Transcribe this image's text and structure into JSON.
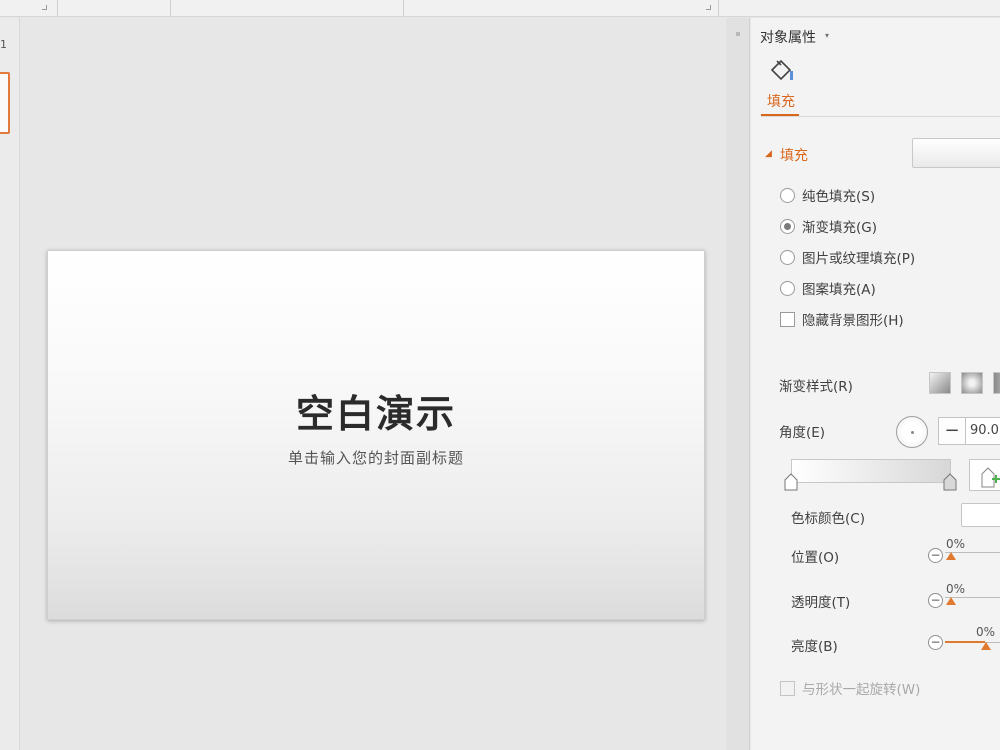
{
  "colors": {
    "accent": "#d9681e",
    "slider_thumb": "#e07a31"
  },
  "thumbnail": {
    "slide_number": "1"
  },
  "slide": {
    "title": "空白演示",
    "subtitle": "单击输入您的封面副标题"
  },
  "pane": {
    "title": "对象属性",
    "title_caret": "▾",
    "tab_fill": {
      "label": "填充",
      "icon": "paint-bucket-icon"
    },
    "section": {
      "caret": "◢",
      "title": "填充"
    },
    "fill_options": [
      {
        "label": "纯色填充(S)",
        "selected": false
      },
      {
        "label": "渐变填充(G)",
        "selected": true
      },
      {
        "label": "图片或纹理填充(P)",
        "selected": false
      },
      {
        "label": "图案填充(A)",
        "selected": false
      }
    ],
    "hide_background": {
      "label": "隐藏背景图形(H)",
      "checked": false
    },
    "gradient_style": {
      "label": "渐变样式(R)"
    },
    "angle": {
      "label": "角度(E)",
      "minus": "−",
      "value": "90.0"
    },
    "stop_color": {
      "label": "色标颜色(C)"
    },
    "position": {
      "label": "位置(O)",
      "minus": "−",
      "value": "0%"
    },
    "transparency": {
      "label": "透明度(T)",
      "minus": "−",
      "value": "0%"
    },
    "brightness": {
      "label": "亮度(B)",
      "minus": "−",
      "value": "0%"
    },
    "rotate_with_shape": {
      "label": "与形状一起旋转(W)",
      "checked": false,
      "disabled": true
    }
  }
}
